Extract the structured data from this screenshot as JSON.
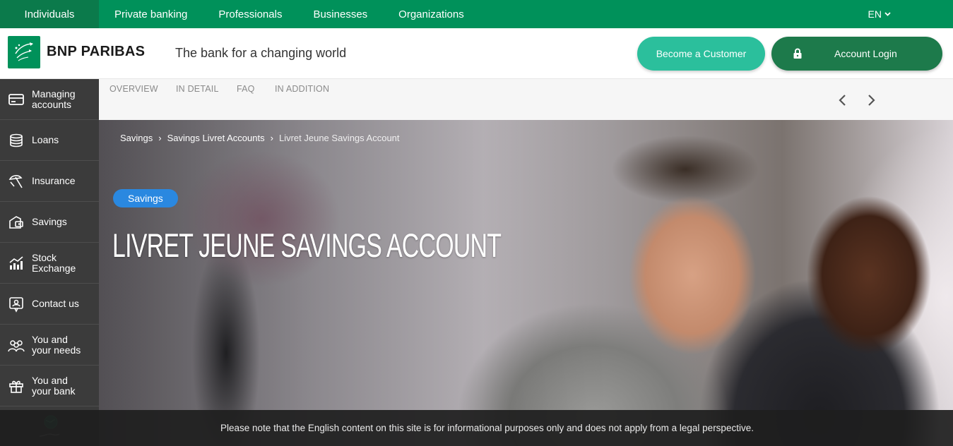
{
  "topnav": {
    "items": [
      {
        "label": "Individuals",
        "active": true
      },
      {
        "label": "Private banking"
      },
      {
        "label": "Professionals"
      },
      {
        "label": "Businesses"
      },
      {
        "label": "Organizations"
      }
    ],
    "language": "EN"
  },
  "header": {
    "brand": "BNP PARIBAS",
    "tagline": "The bank for a changing world",
    "become_customer": "Become a Customer",
    "account_login": "Account Login"
  },
  "sidebar": {
    "items": [
      {
        "label": "Managing accounts",
        "icon": "card-icon"
      },
      {
        "label": "Loans",
        "icon": "coins-icon"
      },
      {
        "label": "Insurance",
        "icon": "umbrella-icon"
      },
      {
        "label": "Savings",
        "icon": "piggy-icon"
      },
      {
        "label": "Stock Exchange",
        "icon": "chart-icon"
      },
      {
        "label": "Contact us",
        "icon": "contact-icon"
      },
      {
        "label": "You and your needs",
        "icon": "people-icon"
      },
      {
        "label": "You and your bank",
        "icon": "gift-icon"
      }
    ]
  },
  "tabs": [
    "OVERVIEW",
    "IN DETAIL",
    "FAQ",
    "IN ADDITION"
  ],
  "hero": {
    "breadcrumb": [
      "Savings",
      "Savings Livret Accounts",
      "Livret Jeune Savings Account"
    ],
    "tag": "Savings",
    "title": "LIVRET JEUNE SAVINGS ACCOUNT"
  },
  "notice": "Please note that the English content on this site is for informational purposes only and does not apply from a legal perspective.",
  "colors": {
    "brand_green": "#00915A",
    "teal": "#2bbf9c",
    "dark_green": "#1d7a4b",
    "sidebar": "#3b3b3b",
    "pill_blue": "#2a88e0"
  }
}
